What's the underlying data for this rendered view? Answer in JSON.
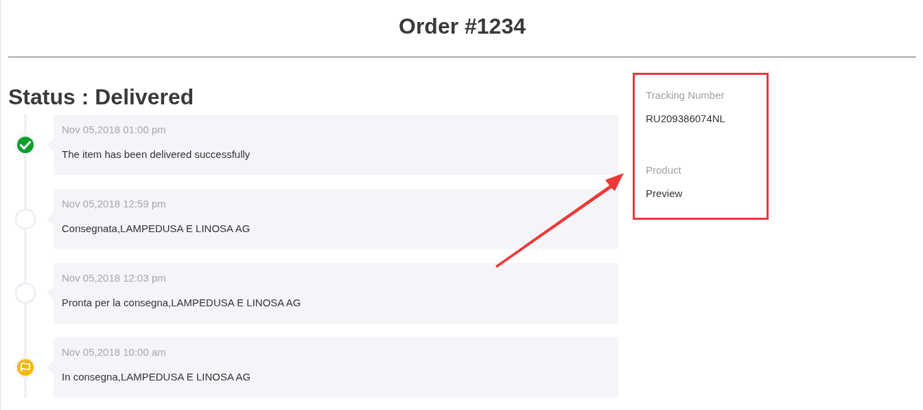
{
  "title": "Order #1234",
  "status_heading": "Status : Delivered",
  "events": [
    {
      "kind": "delivered",
      "date": "Nov 05,2018 01:00 pm",
      "text": "The item has been delivered successfully"
    },
    {
      "kind": "plain",
      "date": "Nov 05,2018 12:59 pm",
      "text": "Consegnata,LAMPEDUSA E LINOSA AG"
    },
    {
      "kind": "plain",
      "date": "Nov 05,2018 12:03 pm",
      "text": "Pronta per la consegna,LAMPEDUSA E LINOSA AG"
    },
    {
      "kind": "flag",
      "date": "Nov 05,2018 10:00 am",
      "text": "In consegna,LAMPEDUSA E LINOSA AG"
    }
  ],
  "details": [
    {
      "label": "Tracking Number",
      "value": "RU209386074NL"
    },
    {
      "label": "Product",
      "value": "Preview"
    }
  ]
}
